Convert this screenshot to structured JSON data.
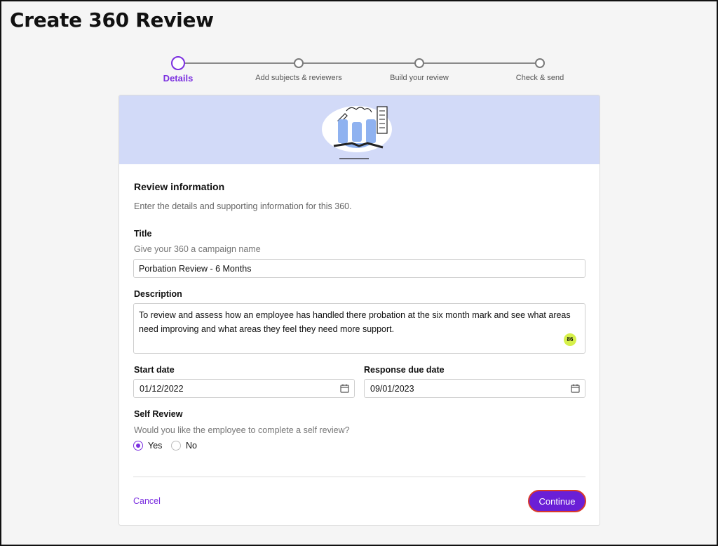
{
  "page": {
    "title": "Create 360 Review"
  },
  "stepper": {
    "steps": [
      {
        "label": "Details",
        "active": true
      },
      {
        "label": "Add subjects & reviewers",
        "active": false
      },
      {
        "label": "Build your review",
        "active": false
      },
      {
        "label": "Check & send",
        "active": false
      }
    ]
  },
  "form": {
    "section_title": "Review information",
    "section_subtitle": "Enter the details and supporting information for this 360.",
    "title_label": "Title",
    "title_hint": "Give your 360 a campaign name",
    "title_value": "Porbation Review - 6 Months",
    "description_label": "Description",
    "description_value": "To review and assess how an employee has handled there probation at the six month mark and see what areas need improving and what areas they feel they need more support.",
    "description_char_count": "86",
    "start_date_label": "Start date",
    "start_date_value": "01/12/2022",
    "due_date_label": "Response due date",
    "due_date_value": "09/01/2023",
    "self_review_label": "Self Review",
    "self_review_question": "Would you like the employee to complete a self review?",
    "self_review_options": [
      {
        "label": "Yes",
        "selected": true
      },
      {
        "label": "No",
        "selected": false
      }
    ],
    "cancel_label": "Cancel",
    "continue_label": "Continue"
  },
  "colors": {
    "accent": "#7b2fe0",
    "button": "#6a1fd6",
    "banner": "#d2daf8",
    "badge": "#d6f04a"
  },
  "icons": [
    "calendar-icon",
    "review-illustration"
  ]
}
